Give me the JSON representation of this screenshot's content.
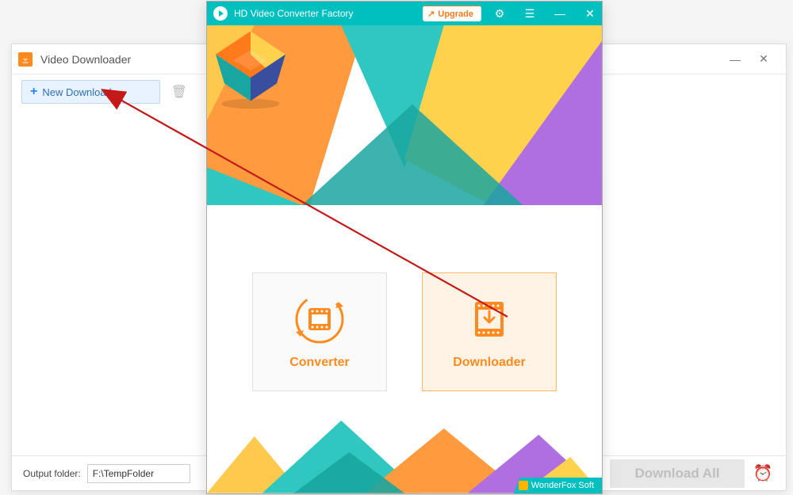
{
  "downloader_window": {
    "title": "Video Downloader",
    "toolbar": {
      "new_download_label": "New Download"
    },
    "footer": {
      "output_folder_label": "Output folder:",
      "output_folder_value": "F:\\TempFolder",
      "download_all_label": "Download All"
    }
  },
  "main_window": {
    "title": "HD Video Converter Factory",
    "upgrade_label": "Upgrade",
    "cards": {
      "converter_label": "Converter",
      "downloader_label": "Downloader"
    },
    "brand": "WonderFox Soft"
  },
  "colors": {
    "accent_orange": "#ff8a1f",
    "accent_teal": "#00bfbf"
  }
}
